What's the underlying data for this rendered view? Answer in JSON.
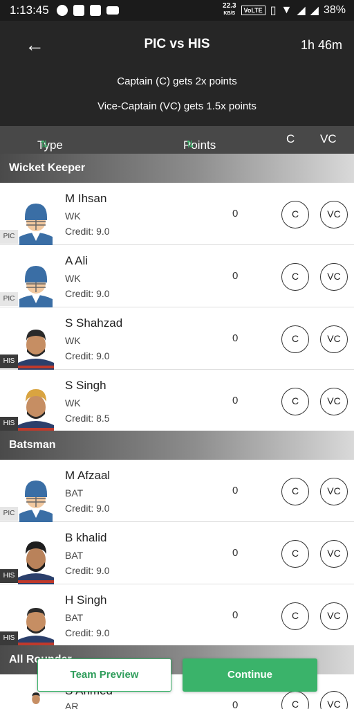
{
  "status_bar": {
    "time": "1:13:45",
    "net_speed_value": "22.3",
    "net_speed_unit": "KB/S",
    "volte": "VoLTE",
    "battery": "38%",
    "icons": [
      "spotify-icon",
      "image-icon",
      "app-icon",
      "laptop-icon",
      "vibrate-icon",
      "wifi-icon",
      "signal-icon",
      "battery-icon"
    ]
  },
  "header": {
    "back_icon": "back-arrow-icon",
    "title": "PIC vs HIS",
    "timer": "1h 46m",
    "rule_captain": "Captain (C) gets 2x points",
    "rule_vice": "Vice-Captain (VC) gets 1.5x points"
  },
  "columns": {
    "type": "Type",
    "points": "Points",
    "c": "C",
    "vc": "VC",
    "sort_icon": "sort-arrows-icon"
  },
  "sections": [
    {
      "title": "Wicket Keeper",
      "players": [
        {
          "name": "M Ihsan",
          "role": "WK",
          "credit": "Credit: 9.0",
          "points": "0",
          "team": "PIC",
          "c": "C",
          "vc": "VC",
          "avatar": "default-helmet-avatar"
        },
        {
          "name": "A Ali",
          "role": "WK",
          "credit": "Credit: 9.0",
          "points": "0",
          "team": "PIC",
          "c": "C",
          "vc": "VC",
          "avatar": "default-helmet-avatar"
        },
        {
          "name": "S Shahzad",
          "role": "WK",
          "credit": "Credit: 9.0",
          "points": "0",
          "team": "HIS",
          "c": "C",
          "vc": "VC",
          "avatar": "player-photo"
        },
        {
          "name": "S Singh",
          "role": "WK",
          "credit": "Credit: 8.5",
          "points": "0",
          "team": "HIS",
          "c": "C",
          "vc": "VC",
          "avatar": "player-photo"
        }
      ]
    },
    {
      "title": "Batsman",
      "players": [
        {
          "name": "M Afzaal",
          "role": "BAT",
          "credit": "Credit: 9.0",
          "points": "0",
          "team": "PIC",
          "c": "C",
          "vc": "VC",
          "avatar": "default-helmet-avatar"
        },
        {
          "name": "B khalid",
          "role": "BAT",
          "credit": "Credit: 9.0",
          "points": "0",
          "team": "HIS",
          "c": "C",
          "vc": "VC",
          "avatar": "player-photo"
        },
        {
          "name": "H Singh",
          "role": "BAT",
          "credit": "Credit: 9.0",
          "points": "0",
          "team": "HIS",
          "c": "C",
          "vc": "VC",
          "avatar": "player-photo"
        }
      ]
    },
    {
      "title": "All Rounder",
      "players": [
        {
          "name": "S Ahmed",
          "role": "AR",
          "credit": "",
          "points": "0",
          "team": "",
          "c": "C",
          "vc": "VC",
          "avatar": "player-photo"
        }
      ]
    }
  ],
  "footer": {
    "team_preview": "Team Preview",
    "continue": "Continue"
  },
  "colors": {
    "header_bg": "#262626",
    "column_header_bg": "#484848",
    "accent_green": "#3ab36a"
  }
}
